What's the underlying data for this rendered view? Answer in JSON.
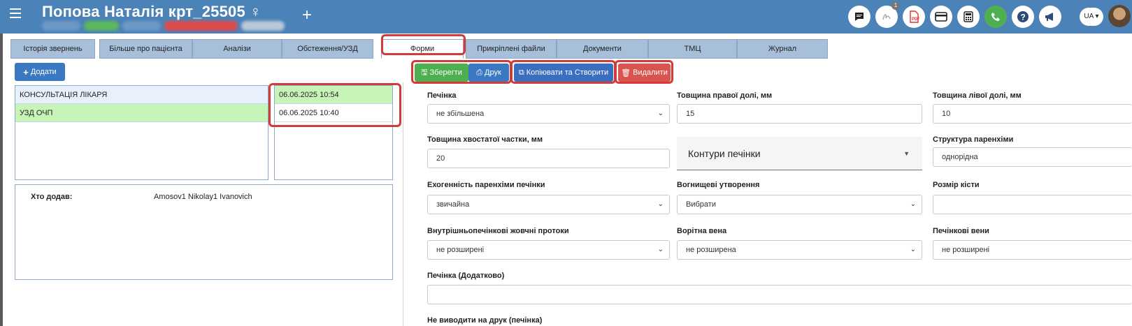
{
  "header": {
    "patient_name": "Попова Наталія крт_25505 ♀",
    "add_symbol": "+",
    "icons": [
      "chat-icon",
      "signature-icon",
      "pdf-icon",
      "card-icon",
      "calculator-icon",
      "phone-icon",
      "help-icon",
      "megaphone-icon"
    ],
    "notification_count": "1",
    "language": "UA"
  },
  "tabs": [
    {
      "label": "Історія звернень"
    },
    {
      "label": "Більше про пацієнта"
    },
    {
      "label": "Аналізи"
    },
    {
      "label": "Обстеження/УЗД"
    },
    {
      "label": "Форми"
    },
    {
      "label": "Прикріплені файли"
    },
    {
      "label": "Документи"
    },
    {
      "label": "ТМЦ"
    },
    {
      "label": "Журнал"
    }
  ],
  "left": {
    "add_button": "Додати",
    "forms": [
      {
        "name": "КОНСУЛЬТАЦІЯ ЛІКАРЯ"
      },
      {
        "name": "УЗД ОЧП"
      }
    ],
    "dates": [
      {
        "value": "06.06.2025 10:54"
      },
      {
        "value": "06.06.2025 10:40"
      }
    ],
    "added_by_label": "Хто додав:",
    "added_by_value": "Amosov1 Nikolay1 Ivanovich"
  },
  "toolbar": {
    "save": "Зберегти",
    "print": "Друк",
    "copy_create": "Копіювати та Створити",
    "delete": "Видалити"
  },
  "form": {
    "liver": {
      "label": "Печінка",
      "value": "не збільшена"
    },
    "right_lobe": {
      "label": "Товщина правої долі, мм",
      "value": "15"
    },
    "left_lobe": {
      "label": "Товщина лівої долі, мм",
      "value": "10"
    },
    "caudate": {
      "label": "Товщина хвостатої частки, мм",
      "value": "20"
    },
    "contours": {
      "value": "Контури печінки"
    },
    "parenchyma_structure": {
      "label": "Структура паренхіми",
      "value": "однорідна"
    },
    "echogenicity": {
      "label": "Ехогенність паренхіми печінки",
      "value": "звичайна"
    },
    "focal": {
      "label": "Вогнищеві утворення",
      "value": "Вибрати"
    },
    "cyst_size": {
      "label": "Розмір кісти",
      "value": ""
    },
    "bile_ducts": {
      "label": "Внутрішньопечінкові жовчні протоки",
      "value": "не розширені"
    },
    "portal_vein": {
      "label": "Ворітна вена",
      "value": "не розширена"
    },
    "hepatic_veins": {
      "label": "Печінкові вени",
      "value": "не розширені"
    },
    "liver_extra": {
      "label": "Печінка (Додатково)",
      "value": ""
    },
    "no_print": {
      "label": "Не виводити на друк (печінка)"
    }
  },
  "colors": {
    "header_bg": "#4b82b8",
    "tab_bg": "#a8bfda",
    "save_green": "#4caf50",
    "print_blue": "#3a78c2",
    "copy_blue": "#3a6fc0",
    "delete_red": "#d9534f",
    "highlight_red": "#d33a3a",
    "selected_green": "#c7f5b7"
  }
}
